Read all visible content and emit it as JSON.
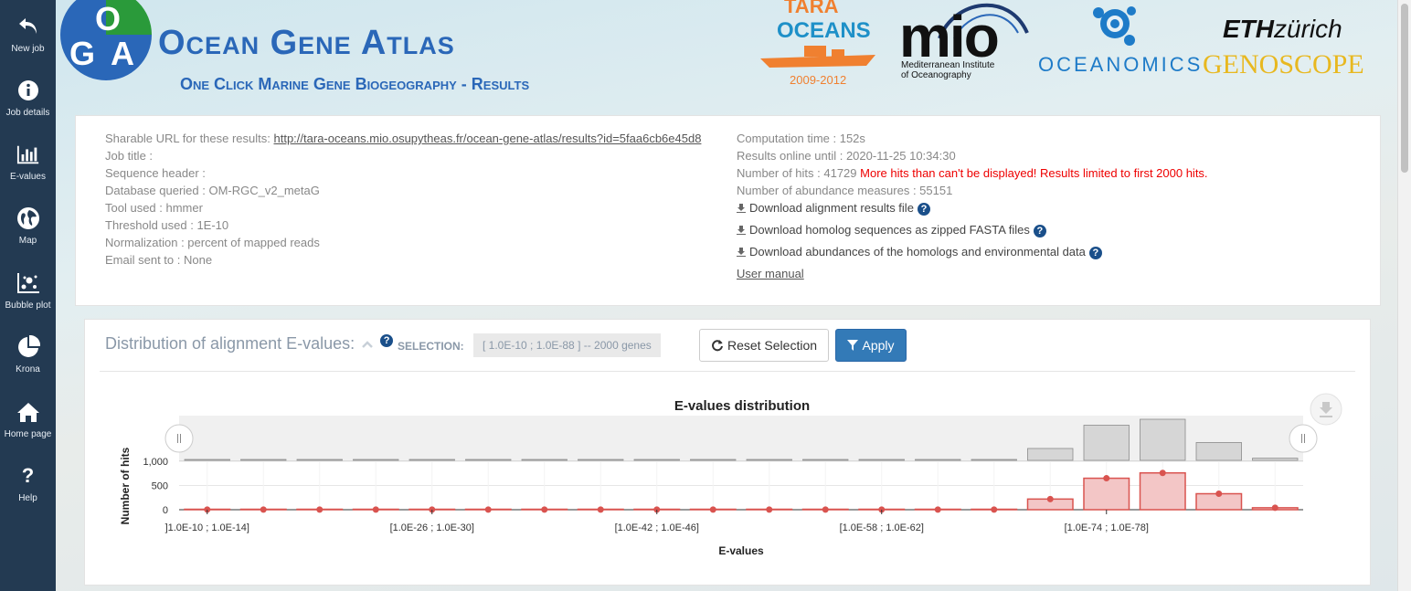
{
  "sidebar": {
    "items": [
      {
        "label": "New job",
        "icon": "undo-arrow-icon"
      },
      {
        "label": "Job details",
        "icon": "info-icon"
      },
      {
        "label": "E-values",
        "icon": "bar-chart-icon"
      },
      {
        "label": "Map",
        "icon": "globe-icon"
      },
      {
        "label": "Bubble plot",
        "icon": "bubble-plot-icon"
      },
      {
        "label": "Krona",
        "icon": "pie-icon"
      },
      {
        "label": "Home page",
        "icon": "home-icon"
      },
      {
        "label": "Help",
        "icon": "question-icon"
      }
    ]
  },
  "header": {
    "logo_letters": [
      "O",
      "G",
      "A"
    ],
    "title": "Ocean Gene Atlas",
    "subtitle": "One Click Marine Gene Biogeography - Results",
    "partners": {
      "tara_line1": "TARA",
      "tara_line2": "OCEANS",
      "tara_years": "2009-2012",
      "mio_word": "mio",
      "mio_line1": "Mediterranean Institute",
      "mio_line2": "of Oceanography",
      "oceanomics": "OCEANOMICS",
      "eth": "ETH",
      "zurich": "zürich",
      "genoscope": "GENOSCOPE"
    }
  },
  "job": {
    "sharable_label": "Sharable URL for these results: ",
    "sharable_url": "http://tara-oceans.mio.osupytheas.fr/ocean-gene-atlas/results?id=5faa6cb6e45d8",
    "job_title": "Job title :",
    "sequence_header": "Sequence header :",
    "database": "Database queried : OM-RGC_v2_metaG",
    "tool": "Tool used : hmmer",
    "threshold": "Threshold used : 1E-10",
    "normalization": "Normalization : percent of mapped reads",
    "email": "Email sent to : None",
    "computation_time": "Computation time : 152s",
    "online_until": "Results online until : 2020-11-25 10:34:30",
    "hits": "Number of hits : 41729",
    "hits_warning": "More hits than can't be displayed! Results limited to first 2000 hits.",
    "abundance": "Number of abundance measures : 55151",
    "download_alignment": "Download alignment results file",
    "download_homolog": "Download homolog sequences as zipped FASTA files",
    "download_abundances": "Download abundances of the homologs and environmental data",
    "user_manual": "User manual"
  },
  "distribution": {
    "title": "Distribution of alignment E-values:",
    "selection_label": "SELECTION:",
    "selection_value": "[ 1.0E-10 ; 1.0E-88 ] -- 2000 genes",
    "reset_label": "Reset Selection",
    "apply_label": "Apply"
  },
  "colors": {
    "sidebar_bg": "#233a52",
    "brand_blue": "#2a67b8",
    "apply_blue": "#337ab7",
    "bar_red": "#d9534f",
    "bar_pink": "#f3c6c6",
    "warning_red": "#e00000"
  },
  "chart_data": {
    "type": "bar",
    "title": "E-values distribution",
    "xlabel": "E-values",
    "ylabel": "Number of hits",
    "ylim": [
      0,
      1000
    ],
    "yticks": [
      "0",
      "500",
      "1,000"
    ],
    "x_tick_labels": [
      "]1.0E-10 ; 1.0E-14]",
      "[1.0E-26 ; 1.0E-30]",
      "[1.0E-42 ; 1.0E-46]",
      "[1.0E-58 ; 1.0E-62]",
      "[1.0E-74 ; 1.0E-78]"
    ],
    "x_tick_positions": [
      0,
      4,
      8,
      12,
      16
    ],
    "bin_count": 20,
    "values": [
      3,
      2,
      2,
      2,
      2,
      2,
      2,
      2,
      2,
      2,
      2,
      2,
      2,
      2,
      2,
      220,
      650,
      760,
      330,
      40
    ],
    "navigator_values": [
      3,
      2,
      2,
      2,
      2,
      2,
      2,
      2,
      2,
      2,
      2,
      2,
      2,
      2,
      2,
      220,
      650,
      760,
      330,
      40
    ],
    "grid": true,
    "legend": "none"
  }
}
